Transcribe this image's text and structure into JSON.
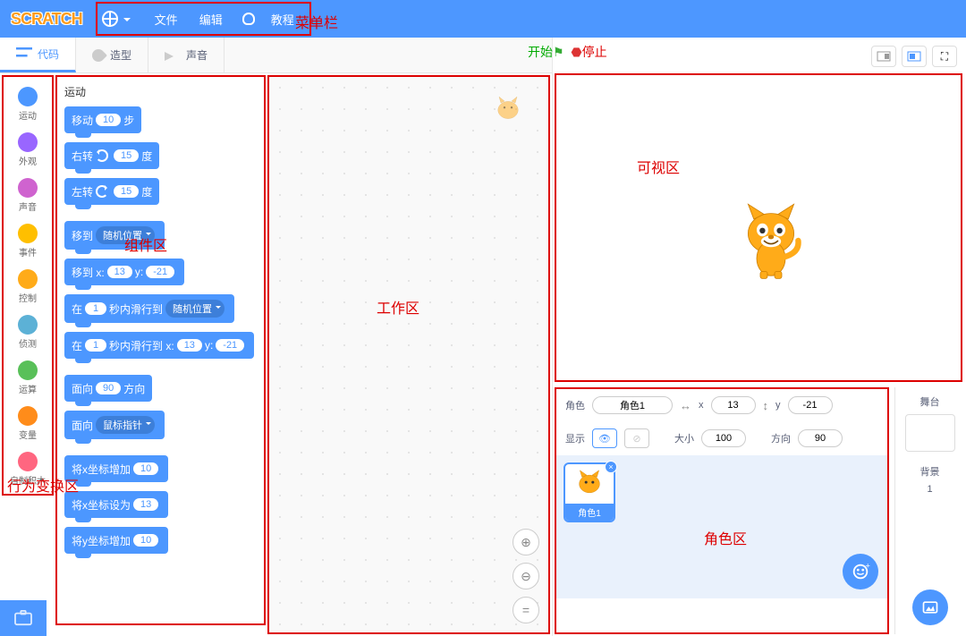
{
  "menubar": {
    "logo": "SCRATCH",
    "file": "文件",
    "edit": "编辑",
    "tutorials": "教程"
  },
  "annotations": {
    "menubar": "菜单栏",
    "start": "开始",
    "stop": "停止",
    "visible": "可视区",
    "palette": "组件区",
    "workspace": "工作区",
    "behavior": "行为变换区",
    "sprites": "角色区"
  },
  "tabs": {
    "code": "代码",
    "costumes": "造型",
    "sounds": "声音"
  },
  "categories": [
    {
      "name": "运动",
      "color": "#4c97ff"
    },
    {
      "name": "外观",
      "color": "#9966ff"
    },
    {
      "name": "声音",
      "color": "#cf63cf"
    },
    {
      "name": "事件",
      "color": "#ffbf00"
    },
    {
      "name": "控制",
      "color": "#ffab19"
    },
    {
      "name": "侦测",
      "color": "#5cb1d6"
    },
    {
      "name": "运算",
      "color": "#59c059"
    },
    {
      "name": "变量",
      "color": "#ff8c1a"
    },
    {
      "name": "自制积木",
      "color": "#ff6680"
    }
  ],
  "palette_title": "运动",
  "blocks": {
    "move_steps": {
      "pre": "移动",
      "val": "10",
      "post": "步"
    },
    "turn_cw": {
      "pre": "右转",
      "val": "15",
      "post": "度"
    },
    "turn_ccw": {
      "pre": "左转",
      "val": "15",
      "post": "度"
    },
    "goto": {
      "pre": "移到",
      "dd": "随机位置"
    },
    "goto_xy": {
      "pre": "移到 x:",
      "x": "13",
      "mid": "y:",
      "y": "-21"
    },
    "glide": {
      "pre": "在",
      "sec": "1",
      "mid": "秒内滑行到",
      "dd": "随机位置"
    },
    "glide_xy": {
      "pre": "在",
      "sec": "1",
      "mid": "秒内滑行到 x:",
      "x": "13",
      "mid2": "y:",
      "y": "-21"
    },
    "point_dir": {
      "pre": "面向",
      "val": "90",
      "post": "方向"
    },
    "point_towards": {
      "pre": "面向",
      "dd": "鼠标指针"
    },
    "change_x": {
      "pre": "将x坐标增加",
      "val": "10"
    },
    "set_x": {
      "pre": "将x坐标设为",
      "val": "13"
    },
    "change_y": {
      "pre": "将y坐标增加",
      "val": "10"
    }
  },
  "sprite_info": {
    "sprite_label": "角色",
    "sprite_name": "角色1",
    "x_label": "x",
    "x": "13",
    "y_label": "y",
    "y": "-21",
    "show_label": "显示",
    "size_label": "大小",
    "size": "100",
    "dir_label": "方向",
    "dir": "90"
  },
  "sprite_tile": {
    "name": "角色1"
  },
  "stage": {
    "label": "舞台",
    "backdrops_label": "背景",
    "backdrops_count": "1"
  }
}
